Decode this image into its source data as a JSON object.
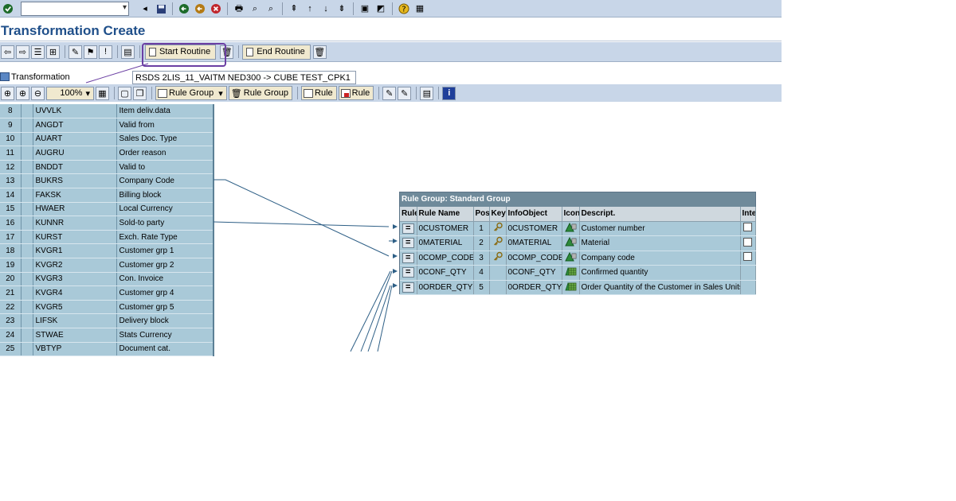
{
  "window": {
    "title": "Transformation Create",
    "command_field": ""
  },
  "app_toolbar": {
    "start_routine_label": "Start Routine",
    "end_routine_label": "End Routine"
  },
  "transformation": {
    "label": "Transformation",
    "value": "RSDS 2LIS_11_VAITM NED300 -> CUBE TEST_CPK1"
  },
  "graphic_toolbar": {
    "zoom": "100%",
    "rule_group_create_label": "Rule Group",
    "rule_group_delete_label": "Rule Group",
    "rule_create_label": "Rule",
    "rule_delete_label": "Rule"
  },
  "source_fields": [
    {
      "n": "8",
      "field": "UVVLK",
      "desc": "Item deliv.data"
    },
    {
      "n": "9",
      "field": "ANGDT",
      "desc": "Valid from"
    },
    {
      "n": "10",
      "field": "AUART",
      "desc": "Sales Doc. Type"
    },
    {
      "n": "11",
      "field": "AUGRU",
      "desc": "Order reason"
    },
    {
      "n": "12",
      "field": "BNDDT",
      "desc": "Valid to"
    },
    {
      "n": "13",
      "field": "BUKRS",
      "desc": "Company Code"
    },
    {
      "n": "14",
      "field": "FAKSK",
      "desc": "Billing block"
    },
    {
      "n": "15",
      "field": "HWAER",
      "desc": "Local Currency"
    },
    {
      "n": "16",
      "field": "KUNNR",
      "desc": "Sold-to party"
    },
    {
      "n": "17",
      "field": "KURST",
      "desc": "Exch. Rate Type"
    },
    {
      "n": "18",
      "field": "KVGR1",
      "desc": "Customer grp 1"
    },
    {
      "n": "19",
      "field": "KVGR2",
      "desc": "Customer grp 2"
    },
    {
      "n": "20",
      "field": "KVGR3",
      "desc": "Con. Invoice"
    },
    {
      "n": "21",
      "field": "KVGR4",
      "desc": "Customer grp 4"
    },
    {
      "n": "22",
      "field": "KVGR5",
      "desc": "Customer grp 5"
    },
    {
      "n": "23",
      "field": "LIFSK",
      "desc": "Delivery block"
    },
    {
      "n": "24",
      "field": "STWAE",
      "desc": "Stats Currency"
    },
    {
      "n": "25",
      "field": "VBTYP",
      "desc": "Document cat."
    }
  ],
  "rule_group": {
    "title": "Rule Group: Standard Group",
    "columns": [
      "Rule",
      "Rule Name",
      "Pos",
      "Key",
      "InfoObject",
      "Icon",
      "Descript.",
      "Inte"
    ],
    "rows": [
      {
        "rule_name": "0CUSTOMER",
        "pos": "1",
        "key": true,
        "infoobject": "0CUSTOMER",
        "icon": "characteristic-icon",
        "descript": "Customer number",
        "checkbox": true
      },
      {
        "rule_name": "0MATERIAL",
        "pos": "2",
        "key": true,
        "infoobject": "0MATERIAL",
        "icon": "characteristic-icon",
        "descript": "Material",
        "checkbox": true
      },
      {
        "rule_name": "0COMP_CODE",
        "pos": "3",
        "key": true,
        "infoobject": "0COMP_CODE",
        "icon": "characteristic-icon",
        "descript": "Company code",
        "checkbox": true
      },
      {
        "rule_name": "0CONF_QTY",
        "pos": "4",
        "key": false,
        "infoobject": "0CONF_QTY",
        "icon": "keyfigure-icon",
        "descript": "Confirmed quantity",
        "checkbox": false
      },
      {
        "rule_name": "0ORDER_QTY",
        "pos": "5",
        "key": false,
        "infoobject": "0ORDER_QTY",
        "icon": "keyfigure-icon",
        "descript": "Order Quantity of the Customer in Sales Units",
        "checkbox": false
      }
    ]
  },
  "colors": {
    "title": "#1f4f8a",
    "toolbar": "#c8d6e8",
    "table_row": "#a9c9d8",
    "highlight": "#6b3fa3",
    "connector": "#2e5f86"
  }
}
